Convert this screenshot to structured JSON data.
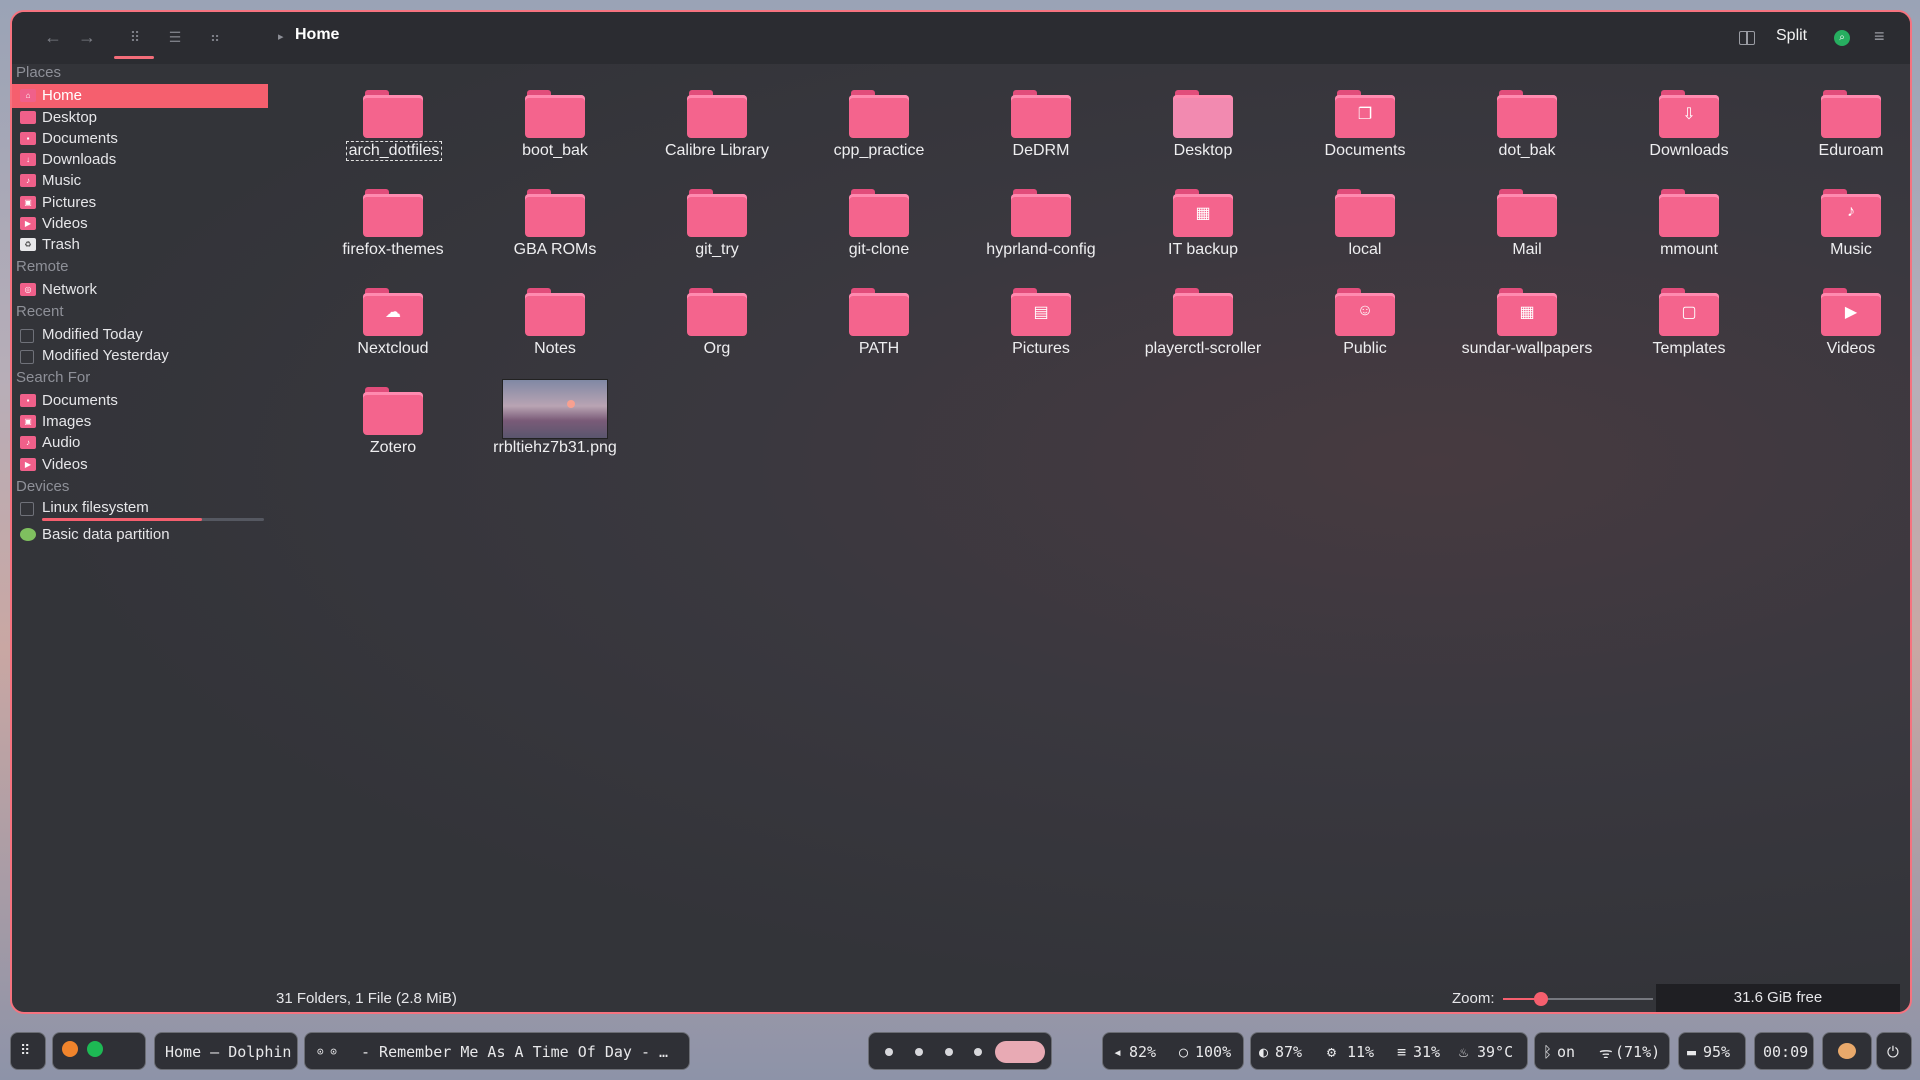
{
  "window": {
    "title": "Home",
    "split_label": "Split"
  },
  "sidebar": {
    "sections": {
      "places": "Places",
      "remote": "Remote",
      "recent": "Recent",
      "search": "Search For",
      "devices": "Devices"
    },
    "places": [
      "Home",
      "Desktop",
      "Documents",
      "Downloads",
      "Music",
      "Pictures",
      "Videos",
      "Trash"
    ],
    "remote": [
      "Network"
    ],
    "recent": [
      "Modified Today",
      "Modified Yesterday"
    ],
    "search": [
      "Documents",
      "Images",
      "Audio",
      "Videos"
    ],
    "devices": [
      "Linux filesystem",
      "Basic data partition"
    ],
    "linux_fs_usage": 0.72
  },
  "files": [
    "arch_dotfiles",
    "boot_bak",
    "Calibre Library",
    "cpp_practice",
    "DeDRM",
    "Desktop",
    "Documents",
    "dot_bak",
    "Downloads",
    "Eduroam",
    "firefox-themes",
    "GBA ROMs",
    "git_try",
    "git-clone",
    "hyprland-config",
    "IT backup",
    "local",
    "Mail",
    "mmount",
    "Music",
    "Nextcloud",
    "Notes",
    "Org",
    "PATH",
    "Pictures",
    "playerctl-scroller",
    "Public",
    "sundar-wallpapers",
    "Templates",
    "Videos",
    "Zotero",
    "rrbltiehz7b31.png"
  ],
  "status": {
    "summary": "31 Folders, 1 File (2.8 MiB)",
    "zoom_label": "Zoom:",
    "zoom_level": 0.25,
    "free_space": "31.6 GiB free"
  },
  "taskbar": {
    "active_window": "Home — Dolphin",
    "media": "- Remember Me As A Time Of Day - …",
    "volume": "82%",
    "brightness": "100%",
    "battery_icon_pct": "87%",
    "cpu": "11%",
    "memory": "31%",
    "temperature": "39°C",
    "bluetooth": "on",
    "wifi": "(71%)",
    "battery": "95%",
    "clock": "00:09"
  },
  "colors": {
    "accent": "#f55f6e",
    "folder": "#f4648d",
    "background": "#343439"
  }
}
